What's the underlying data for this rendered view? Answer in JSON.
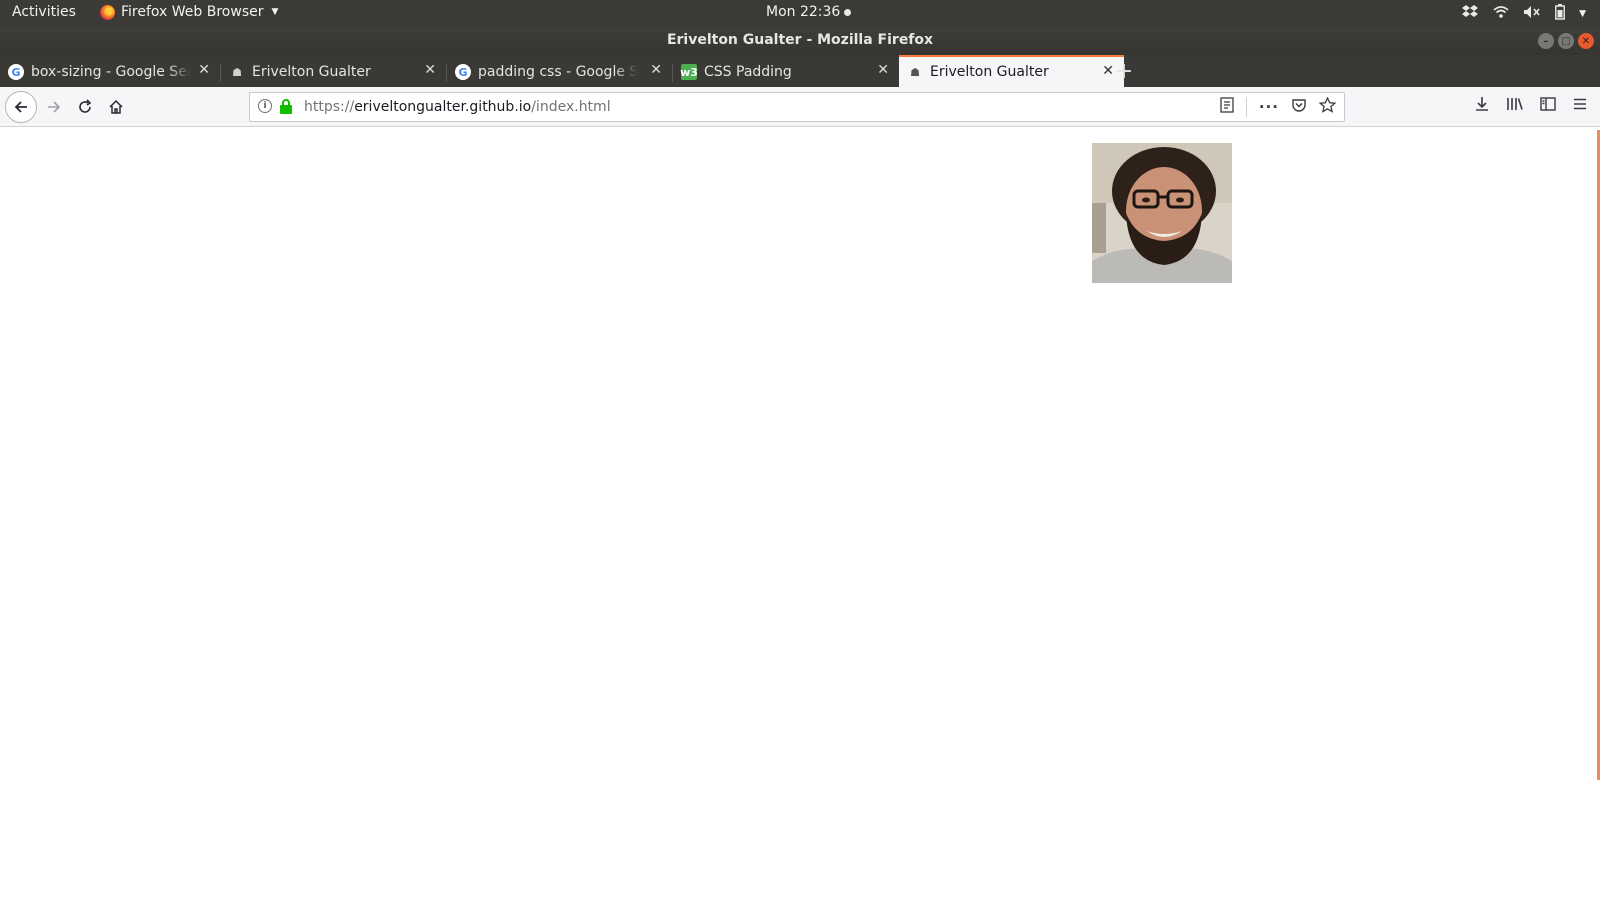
{
  "topbar": {
    "activities": "Activities",
    "app_name": "Firefox Web Browser",
    "clock": "Mon 22:36"
  },
  "window": {
    "title": "Erivelton Gualter - Mozilla Firefox"
  },
  "tabs": [
    {
      "label": "box-sizing - Google Search",
      "favicon": "google-icon",
      "active": false
    },
    {
      "label": "Erivelton Gualter",
      "favicon": "github-pages-icon",
      "active": false
    },
    {
      "label": "padding css - Google Search",
      "favicon": "google-icon",
      "active": false
    },
    {
      "label": "CSS Padding",
      "favicon": "w3schools-icon",
      "active": false
    },
    {
      "label": "Erivelton Gualter",
      "favicon": "github-pages-icon",
      "active": true
    }
  ],
  "urlbar": {
    "protocol": "https://",
    "host": "eriveltongualter.github.io",
    "path": "/index.html"
  },
  "colors": {
    "active_tab_accent": "#ff7b3a",
    "secure_lock": "#12bc00",
    "scroll_accent": "#f08a5d"
  },
  "page": {
    "avatar_alt": "profile-photo"
  }
}
